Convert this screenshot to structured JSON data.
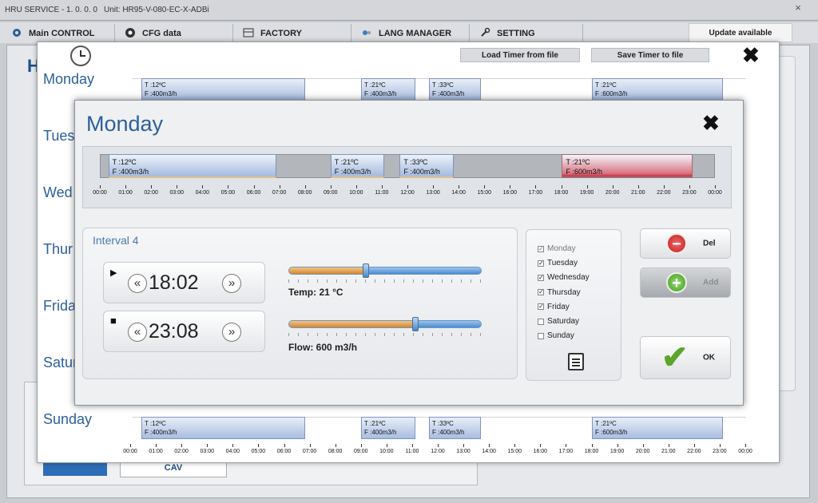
{
  "window": {
    "app_title": "HRU SERVICE - 1. 0. 0. 0",
    "unit": "Unit: HR95-V-080-EC-X-ADBi",
    "close_glyph": "×"
  },
  "tabs": [
    {
      "label": "Main CONTROL",
      "icon": "gear-icon"
    },
    {
      "label": "CFG data",
      "icon": "cfg-icon"
    },
    {
      "label": "FACTORY",
      "icon": "factory-icon"
    },
    {
      "label": "LANG MANAGER",
      "icon": "language-icon"
    },
    {
      "label": "SETTING",
      "icon": "wrench-icon"
    }
  ],
  "update_label": "Update available",
  "background": {
    "header_letter": "H",
    "cav_label": "CAV"
  },
  "week": {
    "load_label": "Load Timer from file",
    "save_label": "Save Timer to file",
    "close_glyph": "✖",
    "days": [
      "Monday",
      "Tues",
      "Wed",
      "Thur",
      "Frida",
      "Satur",
      "Sunday"
    ],
    "top_track_segments": [
      {
        "t": "T :12ºC",
        "f": "F :400m3/h"
      },
      {
        "t": "T :21ºC",
        "f": "F :400m3/h"
      },
      {
        "t": "T :33ºC",
        "f": "F :400m3/h"
      },
      {
        "t": "T :21ºC",
        "f": "F :600m3/h"
      }
    ],
    "bottom_track_segments": [
      {
        "t": "T :12ºC",
        "f": "F :400m3/h"
      },
      {
        "t": "T :21ºC",
        "f": "F :400m3/h"
      },
      {
        "t": "T :33ºC",
        "f": "F :400m3/h"
      },
      {
        "t": "T :21ºC",
        "f": "F :600m3/h"
      }
    ],
    "hours": [
      "00:00",
      "01:00",
      "02:00",
      "03:00",
      "04:00",
      "05:00",
      "06:00",
      "07:00",
      "08:00",
      "09:00",
      "10:00",
      "11:00",
      "12:00",
      "13:00",
      "14:00",
      "15:00",
      "16:00",
      "17:00",
      "18:00",
      "19:00",
      "20:00",
      "21:00",
      "22:00",
      "23:00",
      "00:00"
    ]
  },
  "dialog": {
    "title": "Monday",
    "close_glyph": "✖",
    "segments": [
      {
        "t": "T :12ºC",
        "f": "F :400m3/h",
        "start_h": 0.33,
        "end_h": 6.9,
        "selected": false
      },
      {
        "t": "T :21ºC",
        "f": "F :400m3/h",
        "start_h": 9.0,
        "end_h": 11.1,
        "selected": false
      },
      {
        "t": "T :33ºC",
        "f": "F :400m3/h",
        "start_h": 11.7,
        "end_h": 13.8,
        "selected": false
      },
      {
        "t": "T :21ºC",
        "f": "F :600m3/h",
        "start_h": 18.03,
        "end_h": 23.13,
        "selected": true
      }
    ],
    "interval_label": "Interval 4",
    "start_time": "18:02",
    "end_time": "23:08",
    "prev_glyph": "«",
    "next_glyph": "»",
    "start_glyph": "▶",
    "end_glyph": "■",
    "temp_label": "Temp: 21 °C",
    "temp_level": 0.4,
    "flow_label": "Flow: 600 m3/h",
    "flow_level": 0.66,
    "check_glyph": "✓",
    "days": [
      {
        "label": "Monday",
        "checked": true,
        "dim": true
      },
      {
        "label": "Tuesday",
        "checked": true,
        "dim": false
      },
      {
        "label": "Wednesday",
        "checked": true,
        "dim": false
      },
      {
        "label": "Thursday",
        "checked": true,
        "dim": false
      },
      {
        "label": "Friday",
        "checked": true,
        "dim": false
      },
      {
        "label": "Saturday",
        "checked": false,
        "dim": false
      },
      {
        "label": "Sunday",
        "checked": false,
        "dim": false
      }
    ],
    "del_label": "Del",
    "add_label": "Add",
    "ok_label": "OK",
    "del_glyph": "−",
    "add_glyph": "+",
    "ok_glyph": "✔"
  }
}
